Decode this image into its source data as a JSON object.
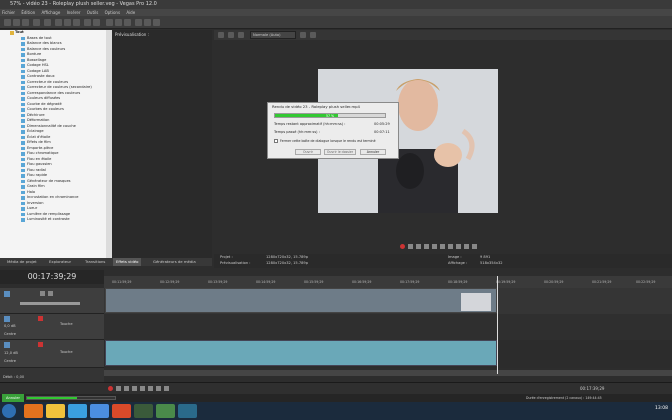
{
  "window": {
    "title": "57% - vidéo 23 - Roleplay plush seller.veg - Vegas Pro 12.0"
  },
  "menu": [
    "Fichier",
    "Édition",
    "Affichage",
    "Insérer",
    "Outils",
    "Options",
    "Aide"
  ],
  "explorer": {
    "root": "Tout",
    "items": [
      "Bases de tout",
      "Balance des blancs",
      "Balance des couleurs",
      "Bordure",
      "Bossellage",
      "Codage HSL",
      "Codage LAB",
      "Contraste doux",
      "Correcteur de couleurs",
      "Correcteur de couleurs (secondaire)",
      "Correspondance des couleurs",
      "Couleurs diffusées",
      "Courbe de dégradé",
      "Courbes de couleurs",
      "Déchirure",
      "Déformation",
      "Dimensionnalité de couche",
      "Éclairage",
      "Éclat d'étoile",
      "Effets de film",
      "Emporte-pièce",
      "Flou chromatique",
      "Flou en étoile",
      "Flou gaussien",
      "Flou radial",
      "Flou rapide",
      "Générateur de masques",
      "Grain film",
      "Halo",
      "Incrustation en chrominance",
      "Inversion",
      "Lueur",
      "Lumière de remplissage",
      "Luminosité et contraste"
    ]
  },
  "preview_panel": {
    "title": "Prévisualisation :"
  },
  "tabs": [
    "Média de projet",
    "Explorateur",
    "Transitions",
    "Effets vidéo",
    "Générateurs de média"
  ],
  "preview_toolbar": {
    "quality": "Normale (Auto)"
  },
  "render_dialog": {
    "title": "Rendu de vidéo 23 - Roleplay plush seller.mp4",
    "progress_pct": 57,
    "progress_label": "57 %",
    "remaining_label": "Temps restant approximatif (hh:mm:ss) :",
    "remaining_value": "00:05:29",
    "elapsed_label": "Temps passé (hh:mm:ss) :",
    "elapsed_value": "00:07:11",
    "checkbox_label": "Fermer cette boîte de dialogue lorsque le rendu est terminé",
    "btn_open": "Ouvrir",
    "btn_folder": "Ouvrir le dossier",
    "btn_cancel": "Annuler"
  },
  "project_info": {
    "project_label": "Projet :",
    "project_value": "1280x720x32, 15.789p",
    "preview_label": "Prévisualisation :",
    "preview_value": "1280x720x32, 15.789p",
    "image_label": "Image :",
    "image_value": "9 891",
    "display_label": "Affichage :",
    "display_value": "518x354x32"
  },
  "timecode": "00:17:39;29",
  "ruler": [
    "00:11:59;29",
    "00:12:59;29",
    "00:13:59;29",
    "00:14:59;29",
    "00:15:59;29",
    "00:16:59;29",
    "00:17:59;29",
    "00:18:59;29",
    "00:19:59;29",
    "00:20:59;29",
    "00:21:59;29",
    "00:22:59;29"
  ],
  "tracks": [
    {
      "level": "",
      "mode": ""
    },
    {
      "level": "0,0 dB",
      "mode": "Centre",
      "touch": "Touche"
    },
    {
      "level": "12,0 dB",
      "mode": "Centre",
      "touch": "Touche"
    }
  ],
  "rate": "Débit : 0,00",
  "transport_time": "00:17:39;29",
  "status": {
    "left": "Annuler",
    "right": "Durée d'enregistrement (2 canaux) : 149:44:45"
  },
  "clock": "13:08"
}
